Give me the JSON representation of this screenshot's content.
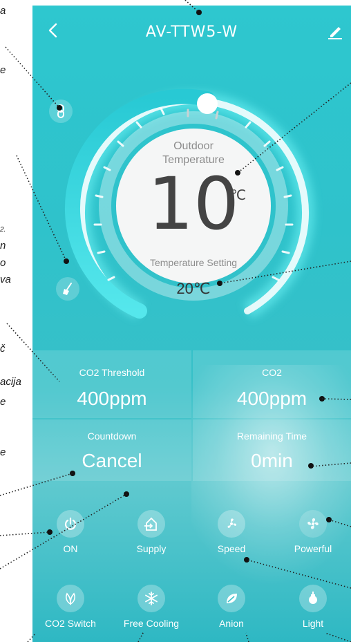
{
  "side_notes": [
    "a",
    "e",
    "2.",
    "n",
    "o",
    "va",
    "č",
    "acija",
    "e",
    "e"
  ],
  "header": {
    "title": "AV-TTW5-W"
  },
  "dial": {
    "outdoor_label_line1": "Outdoor",
    "outdoor_label_line2": "Temperature",
    "outdoor_value": "10",
    "outdoor_unit": "℃",
    "setting_label": "Temperature Setting",
    "setting_value": "20℃"
  },
  "status_grid": [
    {
      "label": "CO2 Threshold",
      "value": "400ppm"
    },
    {
      "label": "CO2",
      "value": "400ppm"
    },
    {
      "label": "Countdown",
      "value": "Cancel"
    },
    {
      "label": "Remaining Time",
      "value": "0min"
    }
  ],
  "controls_row1": [
    {
      "label": "ON",
      "icon": "power-icon",
      "active": true
    },
    {
      "label": "Supply",
      "icon": "home-supply-icon",
      "active": true
    },
    {
      "label": "Speed",
      "icon": "fan-speed-icon",
      "active": true
    },
    {
      "label": "Powerful",
      "icon": "powerful-fan-icon",
      "active": false
    }
  ],
  "controls_row2": [
    {
      "label": "CO2 Switch",
      "icon": "leaf-icon",
      "active": true
    },
    {
      "label": "Free Cooling",
      "icon": "snowflake-icon",
      "active": true
    },
    {
      "label": "Anion",
      "icon": "anion-leaf-icon",
      "active": true
    },
    {
      "label": "Light",
      "icon": "light-bulb-icon",
      "active": true
    }
  ],
  "colors": {
    "accent": "#2ec7cf",
    "dial_arc": "#3fe0e8",
    "white": "#ffffff"
  }
}
